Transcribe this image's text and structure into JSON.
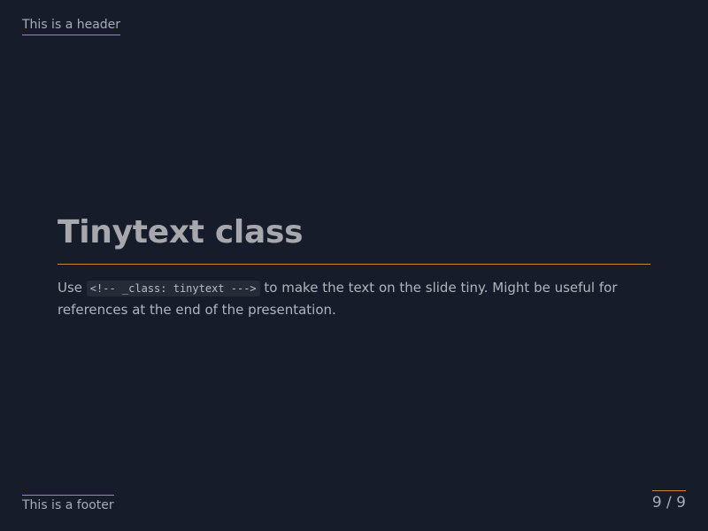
{
  "header": {
    "text": "This is a header"
  },
  "slide": {
    "title": "Tinytext class",
    "body": {
      "prefix": "Use ",
      "code": "<!-- _class: tinytext --->",
      "suffix": " to make the text on the slide tiny. Might be useful for references at the end of the presentation."
    }
  },
  "footer": {
    "text": "This is a footer"
  },
  "pagination": {
    "label": "9 / 9"
  },
  "colors": {
    "background": "#171c2a",
    "accent": "#c98a2e",
    "title": "#a6a8ad",
    "text": "#b0b4bc"
  }
}
